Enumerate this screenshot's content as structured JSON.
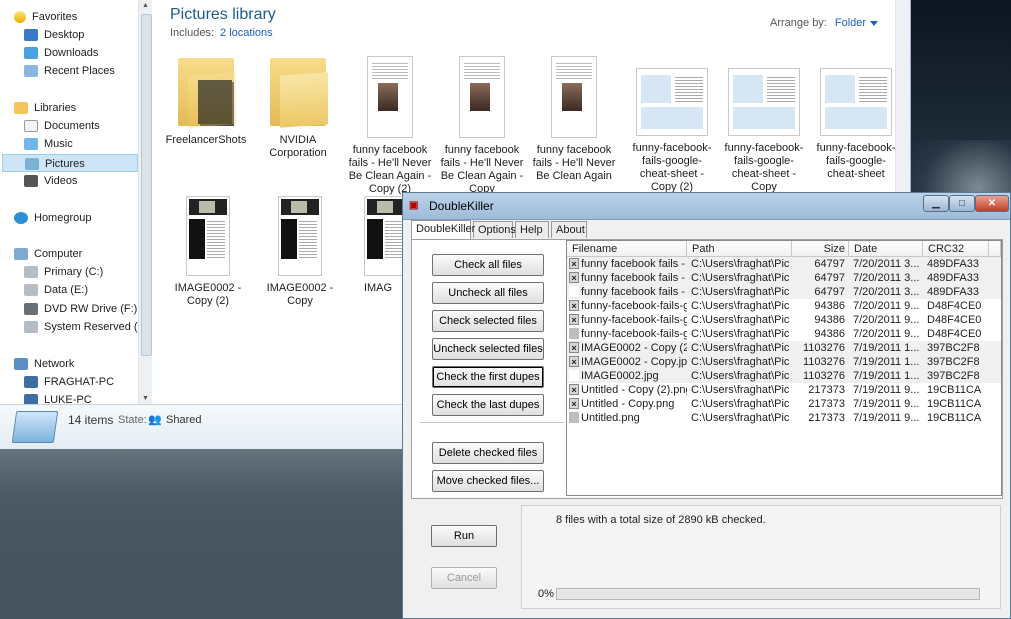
{
  "explorer": {
    "nav": {
      "favorites_label": "Favorites",
      "favorites": [
        "Desktop",
        "Downloads",
        "Recent Places"
      ],
      "libraries_label": "Libraries",
      "libraries": [
        "Documents",
        "Music",
        "Pictures",
        "Videos"
      ],
      "homegroup_label": "Homegroup",
      "computer_label": "Computer",
      "drives": [
        "Primary (C:)",
        "Data (E:)",
        "DVD RW Drive (F:) FL",
        "System Reserved (H:"
      ],
      "network_label": "Network",
      "network": [
        "FRAGHAT-PC",
        "LUKE-PC"
      ],
      "selected": "Pictures"
    },
    "library": {
      "title": "Pictures library",
      "includes_label": "Includes:",
      "includes_link": "2 locations",
      "arrange_label": "Arrange by:",
      "arrange_value": "Folder"
    },
    "files": [
      {
        "name": "FreelancerShots",
        "kind": "folder-dark"
      },
      {
        "name": "NVIDIA Corporation",
        "kind": "folder-light"
      },
      {
        "name": "funny facebook fails - He'll Never Be Clean Again - Copy (2)",
        "kind": "doc"
      },
      {
        "name": "funny facebook fails - He'll Never Be Clean Again - Copy",
        "kind": "doc"
      },
      {
        "name": "funny facebook fails - He'll Never Be Clean Again",
        "kind": "doc"
      },
      {
        "name": "funny-facebook-fails-google-cheat-sheet - Copy (2)",
        "kind": "sheet"
      },
      {
        "name": "funny-facebook-fails-google-cheat-sheet - Copy",
        "kind": "sheet"
      },
      {
        "name": "funny-facebook-fails-google-cheat-sheet",
        "kind": "sheet"
      },
      {
        "name": "IMAGE0002 - Copy (2)",
        "kind": "img"
      },
      {
        "name": "IMAGE0002 - Copy",
        "kind": "img"
      },
      {
        "name": "IMAG",
        "kind": "img"
      }
    ],
    "details": {
      "count": "14 items",
      "state_label": "State:",
      "state_value": "Shared"
    }
  },
  "doublekiller": {
    "title": "DoubleKiller",
    "tabs": [
      "DoubleKiller",
      "Options",
      "Help",
      "About"
    ],
    "active_tab": "DoubleKiller",
    "buttons": {
      "check_all": "Check all files",
      "uncheck_all": "Uncheck all files",
      "check_selected": "Check selected files",
      "uncheck_selected": "Uncheck selected files",
      "check_first": "Check the first dupes",
      "check_last": "Check the last dupes",
      "delete_checked": "Delete checked files",
      "move_checked": "Move checked files...",
      "run": "Run",
      "cancel": "Cancel"
    },
    "columns": [
      "Filename",
      "Path",
      "Size",
      "Date",
      "CRC32"
    ],
    "rows": [
      {
        "check": "x",
        "name": "funny facebook fails - ...",
        "path": "C:\\Users\\fraghat\\Pic...",
        "size": "64797",
        "date": "7/20/2011 3...",
        "crc": "489DFA33",
        "shade": true
      },
      {
        "check": "x",
        "name": "funny facebook fails - ...",
        "path": "C:\\Users\\fraghat\\Pic...",
        "size": "64797",
        "date": "7/20/2011 3...",
        "crc": "489DFA33",
        "shade": true
      },
      {
        "check": "none",
        "name": "funny facebook fails - ...",
        "path": "C:\\Users\\fraghat\\Pic...",
        "size": "64797",
        "date": "7/20/2011 3...",
        "crc": "489DFA33",
        "shade": true
      },
      {
        "check": "x",
        "name": "funny-facebook-fails-go...",
        "path": "C:\\Users\\fraghat\\Pic...",
        "size": "94386",
        "date": "7/20/2011 9...",
        "crc": "D48F4CE0",
        "shade": false
      },
      {
        "check": "x",
        "name": "funny-facebook-fails-go...",
        "path": "C:\\Users\\fraghat\\Pic...",
        "size": "94386",
        "date": "7/20/2011 9...",
        "crc": "D48F4CE0",
        "shade": false
      },
      {
        "check": "gray",
        "name": "funny-facebook-fails-go...",
        "path": "C:\\Users\\fraghat\\Pic...",
        "size": "94386",
        "date": "7/20/2011 9...",
        "crc": "D48F4CE0",
        "shade": false
      },
      {
        "check": "x",
        "name": "IMAGE0002 - Copy (2).j...",
        "path": "C:\\Users\\fraghat\\Pic...",
        "size": "1103276",
        "date": "7/19/2011 1...",
        "crc": "397BC2F8",
        "shade": true
      },
      {
        "check": "x",
        "name": "IMAGE0002 - Copy.jpg",
        "path": "C:\\Users\\fraghat\\Pic...",
        "size": "1103276",
        "date": "7/19/2011 1...",
        "crc": "397BC2F8",
        "shade": true
      },
      {
        "check": "none",
        "name": "IMAGE0002.jpg",
        "path": "C:\\Users\\fraghat\\Pic...",
        "size": "1103276",
        "date": "7/19/2011 1...",
        "crc": "397BC2F8",
        "shade": true
      },
      {
        "check": "x",
        "name": "Untitled - Copy (2).png",
        "path": "C:\\Users\\fraghat\\Pic...",
        "size": "217373",
        "date": "7/19/2011 9...",
        "crc": "19CB11CA",
        "shade": false
      },
      {
        "check": "x",
        "name": "Untitled - Copy.png",
        "path": "C:\\Users\\fraghat\\Pic...",
        "size": "217373",
        "date": "7/19/2011 9...",
        "crc": "19CB11CA",
        "shade": false
      },
      {
        "check": "gray",
        "name": "Untitled.png",
        "path": "C:\\Users\\fraghat\\Pic...",
        "size": "217373",
        "date": "7/19/2011 9...",
        "crc": "19CB11CA",
        "shade": false
      }
    ],
    "status": {
      "message": "8 files with a total size of 2890 kB checked.",
      "progress_label": "0%",
      "progress": 0
    }
  }
}
